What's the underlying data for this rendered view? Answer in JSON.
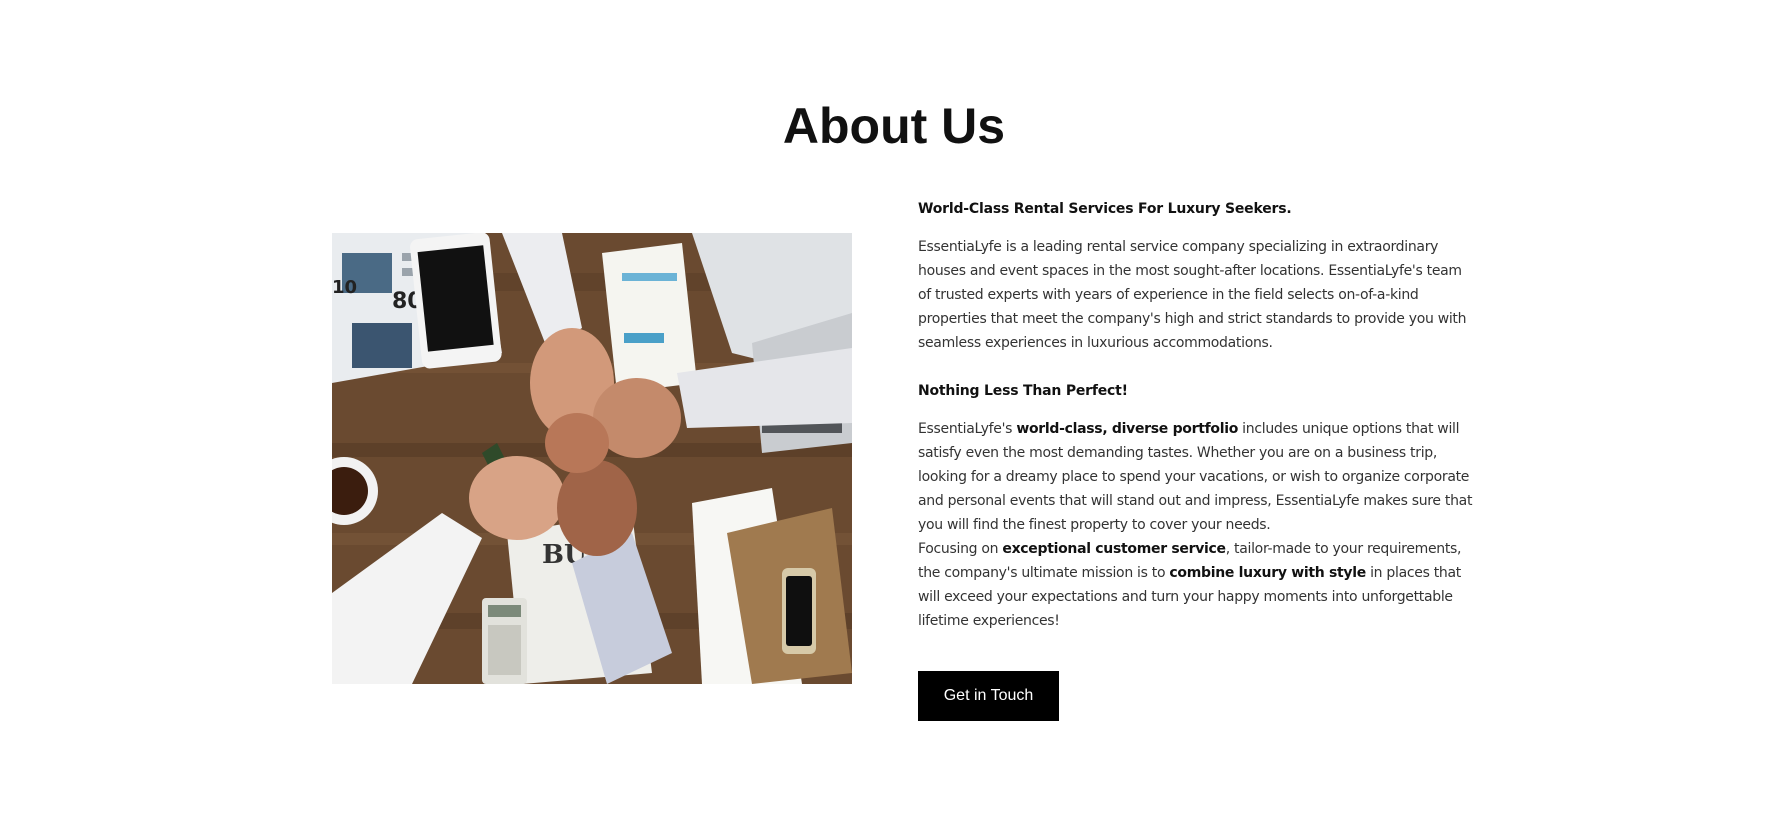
{
  "about": {
    "title": "About Us",
    "heading_1": "World-Class Rental Services For Luxury Seekers.",
    "paragraph_1": "EssentiaLyfe is a leading rental service company specializing in extraordinary houses and event spaces in the most sought-after locations. EssentiaLyfe's team of trusted experts with years of experience in the field selects on-of-a-kind properties that meet the company's high and strict standards to provide you with seamless experiences in luxurious accommodations.",
    "heading_2": "Nothing Less Than Perfect!",
    "paragraph_2": {
      "part_1": "EssentiaLyfe's ",
      "bold_1": "world-class, diverse portfolio",
      "part_2": " includes unique options that will satisfy even the most demanding tastes. Whether you are on a business trip, looking for a dreamy place to spend your vacations, or wish to organize corporate and personal events that will stand out and impress, EssentiaLyfe makes sure that you will find the finest property to cover your needs."
    },
    "paragraph_3": {
      "part_1": "Focusing on ",
      "bold_1": "exceptional customer service",
      "part_2": ", tailor-made to your requirements, the company's ultimate mission is to ",
      "bold_2": "combine luxury with style",
      "part_3": " in places that will exceed your expectations and turn your happy moments into unforgettable lifetime experiences!"
    },
    "cta_label": "Get in Touch",
    "photo_text": {
      "newspaper_a": "BUS",
      "newspaper_b": "80",
      "newspaper_c": "10"
    }
  },
  "colors": {
    "title": "#111111",
    "body_text": "#333333",
    "button_bg": "#000000",
    "button_text": "#ffffff"
  }
}
